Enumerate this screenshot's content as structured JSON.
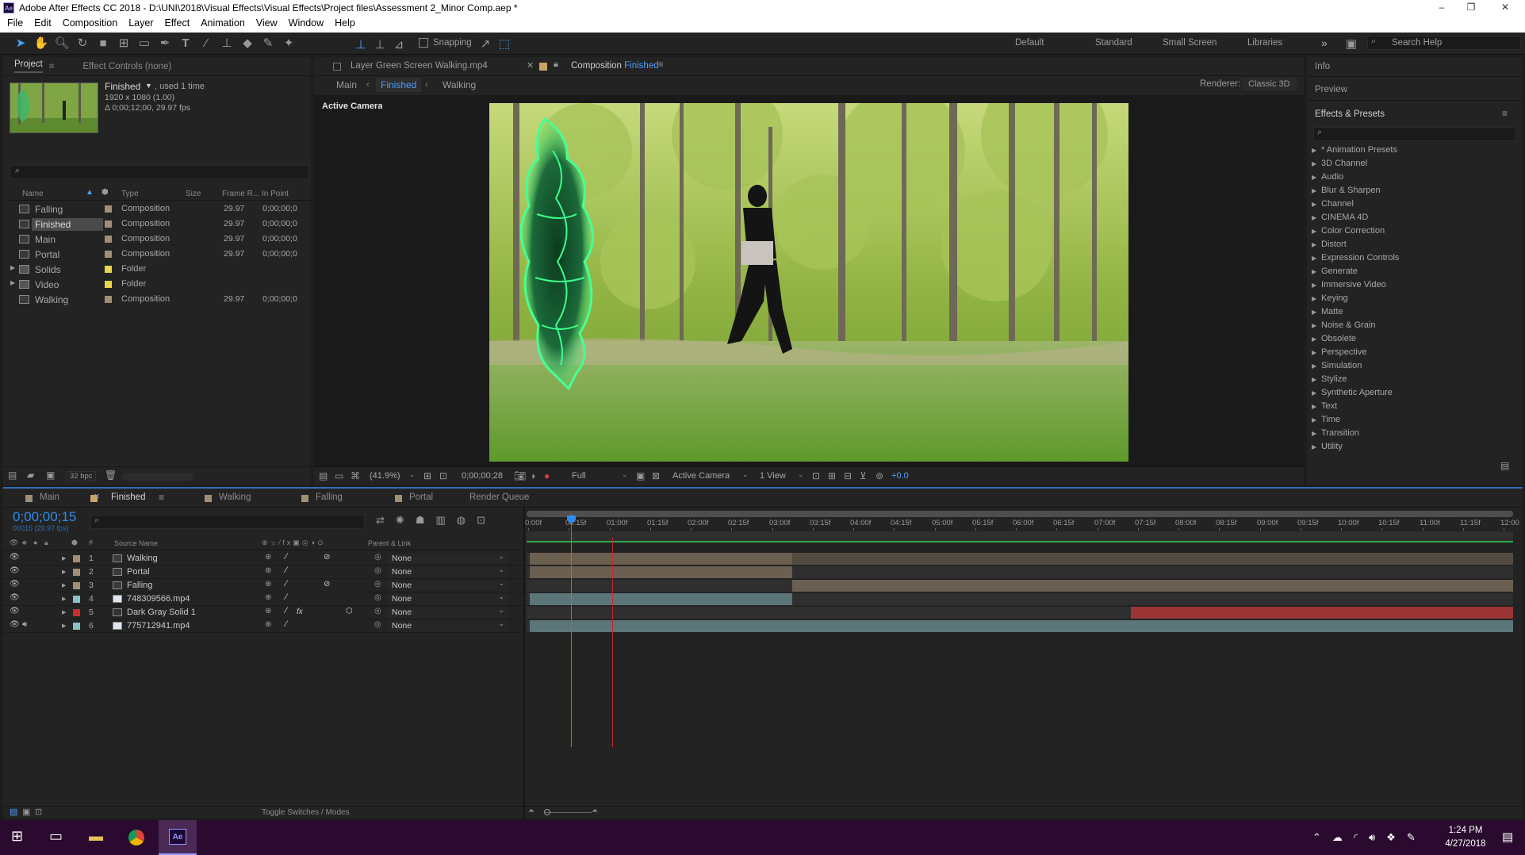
{
  "titlebar": {
    "title": "Adobe After Effects CC 2018 - D:\\UNI\\2018\\Visual Effects\\Visual Effects\\Project files\\Assessment 2_Minor Comp.aep *",
    "min": "–",
    "max": "❐",
    "close": "✕"
  },
  "menu": [
    "File",
    "Edit",
    "Composition",
    "Layer",
    "Effect",
    "Animation",
    "View",
    "Window",
    "Help"
  ],
  "toolbar": {
    "snapping": "Snapping",
    "workspaces": [
      "Default",
      "Standard",
      "Small Screen",
      "Libraries"
    ],
    "more": "»",
    "search_placeholder": "Search Help"
  },
  "project": {
    "tab_project": "Project",
    "tab_effect_controls": "Effect Controls (none)",
    "selected_name": "Finished",
    "used": ", used 1 time",
    "dims": "1920 x 1080 (1.00)",
    "duration": "Δ 0;00;12;00, 29.97 fps",
    "columns": [
      "Name",
      "Type",
      "Size",
      "Frame R...",
      "In Point"
    ],
    "items": [
      {
        "name": "Falling",
        "type": "Composition",
        "fps": "29.97",
        "inpoint": "0;00;00;0",
        "color": "#a08f78",
        "kind": "comp"
      },
      {
        "name": "Finished",
        "type": "Composition",
        "fps": "29.97",
        "inpoint": "0;00;00;0",
        "color": "#a08f78",
        "kind": "comp"
      },
      {
        "name": "Main",
        "type": "Composition",
        "fps": "29.97",
        "inpoint": "0;00;00;0",
        "color": "#a08f78",
        "kind": "comp"
      },
      {
        "name": "Portal",
        "type": "Composition",
        "fps": "29.97",
        "inpoint": "0;00;00;0",
        "color": "#a08f78",
        "kind": "comp"
      },
      {
        "name": "Solids",
        "type": "Folder",
        "fps": "",
        "inpoint": "",
        "color": "#e8d44d",
        "kind": "folder"
      },
      {
        "name": "Video",
        "type": "Folder",
        "fps": "",
        "inpoint": "",
        "color": "#e8d44d",
        "kind": "folder"
      },
      {
        "name": "Walking",
        "type": "Composition",
        "fps": "29.97",
        "inpoint": "0;00;00;0",
        "color": "#a08f78",
        "kind": "comp"
      }
    ],
    "bpc": "32 bpc"
  },
  "viewer": {
    "tab_layer": "Layer  Green Screen Walking.mp4",
    "tab_comp_prefix": "Composition ",
    "tab_comp_name": "Finished",
    "crumbs": [
      "Main",
      "Finished",
      "Walking"
    ],
    "renderer_label": "Renderer:",
    "renderer": "Classic 3D",
    "active_camera": "Active Camera",
    "footer": {
      "zoom": "(41.9%)",
      "timecode": "0;00;00;28",
      "resolution": "Full",
      "camera": "Active Camera",
      "views": "1 View",
      "exposure": "+0.0"
    }
  },
  "right": {
    "info": "Info",
    "preview": "Preview",
    "effects_presets": "Effects & Presets",
    "categories": [
      "* Animation Presets",
      "3D Channel",
      "Audio",
      "Blur & Sharpen",
      "Channel",
      "CINEMA 4D",
      "Color Correction",
      "Distort",
      "Expression Controls",
      "Generate",
      "Immersive Video",
      "Keying",
      "Matte",
      "Noise & Grain",
      "Obsolete",
      "Perspective",
      "Simulation",
      "Stylize",
      "Synthetic Aperture",
      "Text",
      "Time",
      "Transition",
      "Utility"
    ]
  },
  "timeline": {
    "tabs": [
      "Main",
      "Finished",
      "Walking",
      "Falling",
      "Portal",
      "Render Queue"
    ],
    "timecode": "0;00;00;15",
    "timecode_sub": "00015 (29.97 fps)",
    "col_source": "Source Name",
    "col_parent": "Parent & Link",
    "layers": [
      {
        "num": "1",
        "name": "Walking",
        "parent": "None",
        "color": "#a08f78",
        "kind": "comp",
        "fx": "",
        "bar_start": 0.0,
        "bar_end": 1.0,
        "bar_color": "#6a5f51",
        "split": 0.267
      },
      {
        "num": "2",
        "name": "Portal",
        "parent": "None",
        "color": "#a08f78",
        "kind": "comp",
        "fx": "",
        "bar_start": 0.0,
        "bar_end": 0.267,
        "bar_color": "#6a5f51",
        "split": 0
      },
      {
        "num": "3",
        "name": "Falling",
        "parent": "None",
        "color": "#a08f78",
        "kind": "comp",
        "fx": "",
        "bar_start": 0.267,
        "bar_end": 1.0,
        "bar_color": "#6a5f51",
        "split": 0
      },
      {
        "num": "4",
        "name": "748309566.mp4",
        "parent": "None",
        "color": "#8ac2c4",
        "kind": "file",
        "fx": "",
        "bar_start": 0.0,
        "bar_end": 0.267,
        "bar_color": "#5c7579",
        "split": 0
      },
      {
        "num": "5",
        "name": "Dark Gray Solid 1",
        "parent": "None",
        "color": "#c8302f",
        "kind": "solid",
        "fx": "fx",
        "bar_start": 0.611,
        "bar_end": 1.0,
        "bar_color": "#9b3434",
        "split": 0
      },
      {
        "num": "6",
        "name": "775712941.mp4",
        "parent": "None",
        "color": "#8ac2c4",
        "kind": "file",
        "fx": "",
        "bar_start": 0.0,
        "bar_end": 1.0,
        "bar_color": "#5c7579",
        "split": 0
      }
    ],
    "ruler": [
      "0:00f",
      "00:15f",
      "01:00f",
      "01:15f",
      "02:00f",
      "02:15f",
      "03:00f",
      "03:15f",
      "04:00f",
      "04:15f",
      "05:00f",
      "05:15f",
      "06:00f",
      "06:15f",
      "07:00f",
      "07:15f",
      "08:00f",
      "08:15f",
      "09:00f",
      "09:15f",
      "10:00f",
      "10:15f",
      "11:00f",
      "11:15f",
      "12:00"
    ],
    "playhead_fraction": 0.042,
    "toggle": "Toggle Switches / Modes"
  },
  "taskbar": {
    "time": "1:24 PM",
    "date": "4/27/2018"
  },
  "colors": {
    "accent": "#2d8ceb",
    "timecode": "#2d8ceb",
    "panel": "#232323",
    "titlebar": "#ffffff"
  }
}
